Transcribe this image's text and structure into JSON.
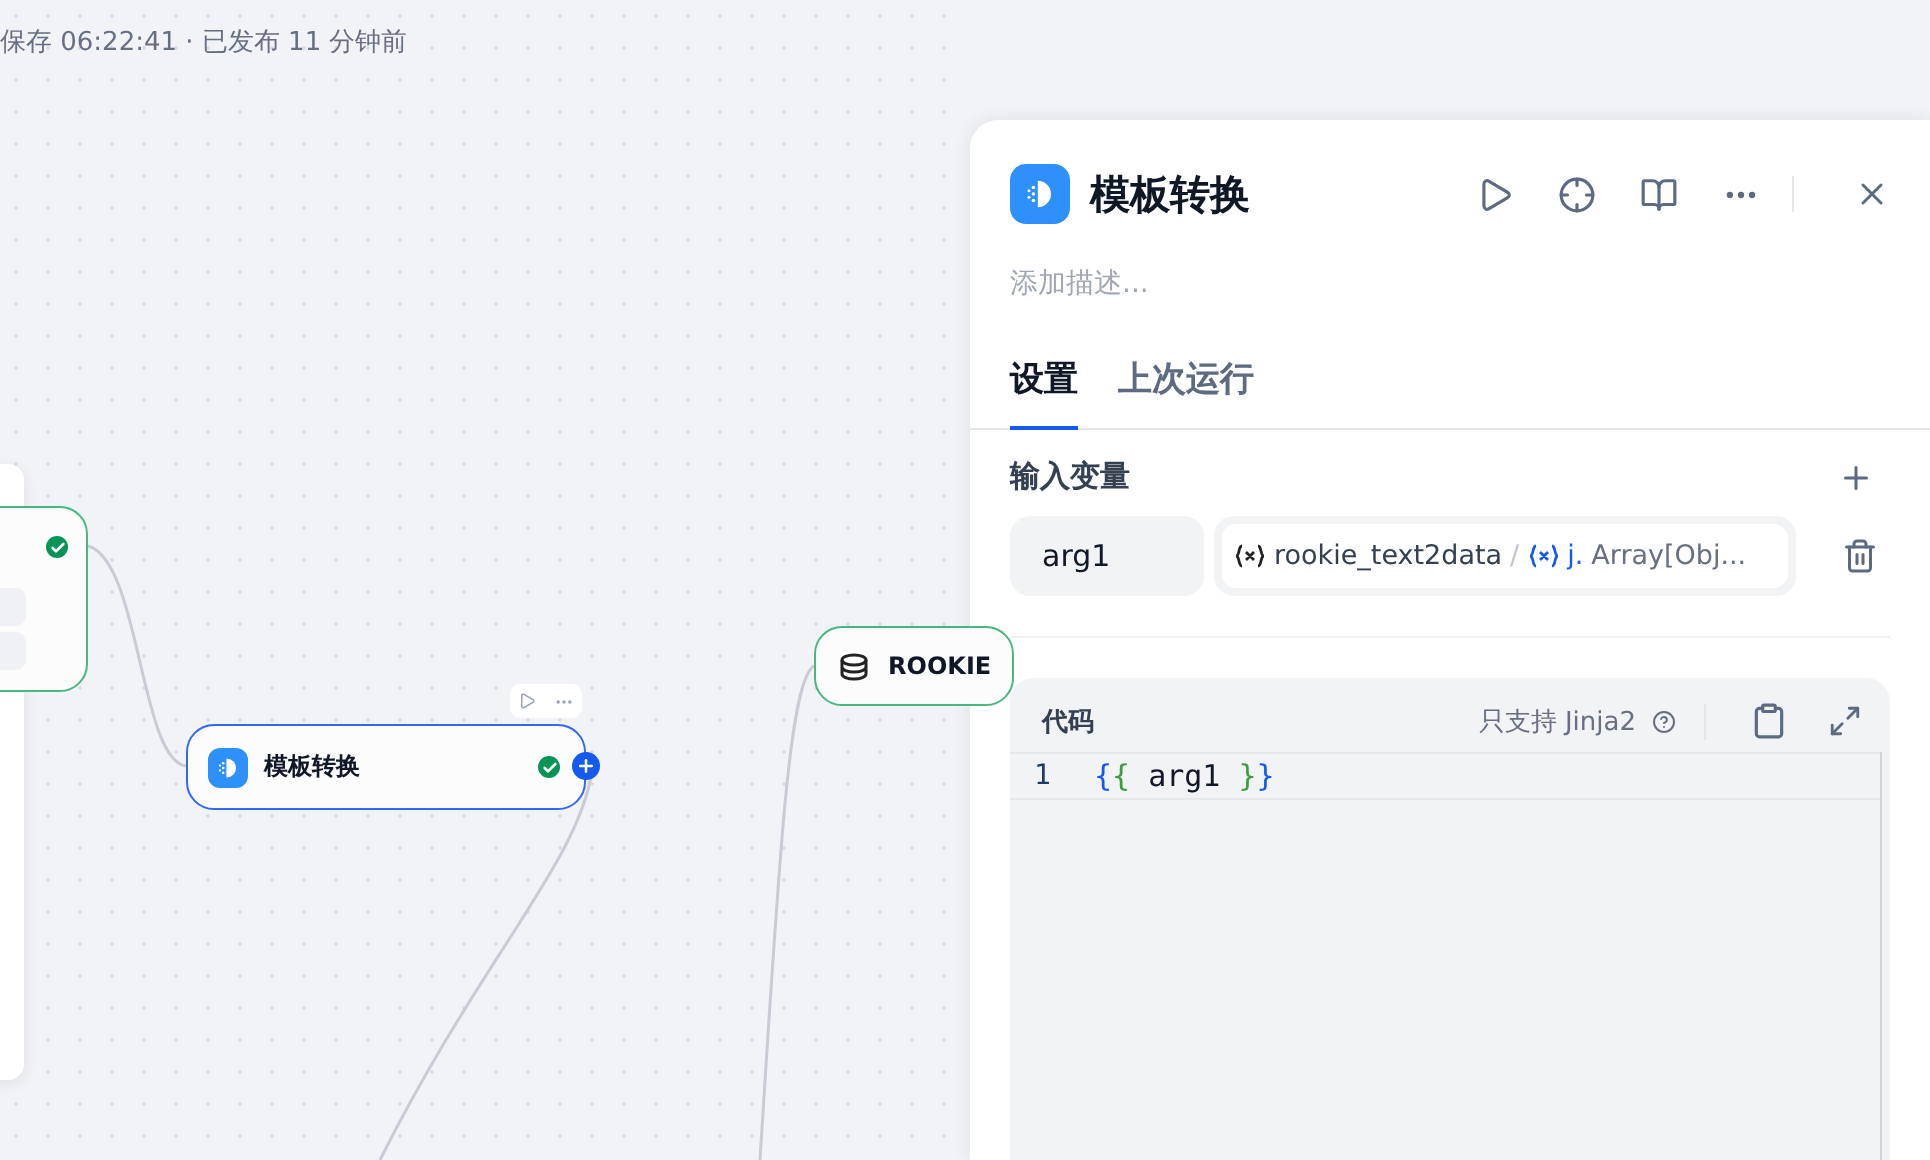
{
  "canvas": {
    "status": "保存 06:22:41 · 已发布 11 分钟前",
    "nodes": [
      {
        "title": "模板转换",
        "selected": true,
        "success": true
      },
      {
        "title": "ROOKIE",
        "selected": false,
        "success": false
      }
    ]
  },
  "panel": {
    "title": "模板转换",
    "description": {
      "placeholder": "添加描述..."
    },
    "tabs": [
      {
        "label": "设置",
        "selected": true
      },
      {
        "label": "上次运行",
        "selected": false
      }
    ],
    "inputs": {
      "title": "输入变量",
      "variables": [
        {
          "name": "arg1",
          "source": "rookie_text2data",
          "separator": "/",
          "field": "j.",
          "type": "Array[Obj..."
        }
      ]
    },
    "code": {
      "title": "代码",
      "hint": "只支持 Jinja2",
      "lines": [
        {
          "number": "1",
          "tokens": [
            {
              "text": "{",
              "kind": "outer"
            },
            {
              "text": "{",
              "kind": "inner"
            },
            {
              "text": " arg1 ",
              "kind": "plain"
            },
            {
              "text": "}",
              "kind": "inner"
            },
            {
              "text": "}",
              "kind": "outer"
            }
          ]
        }
      ]
    }
  }
}
